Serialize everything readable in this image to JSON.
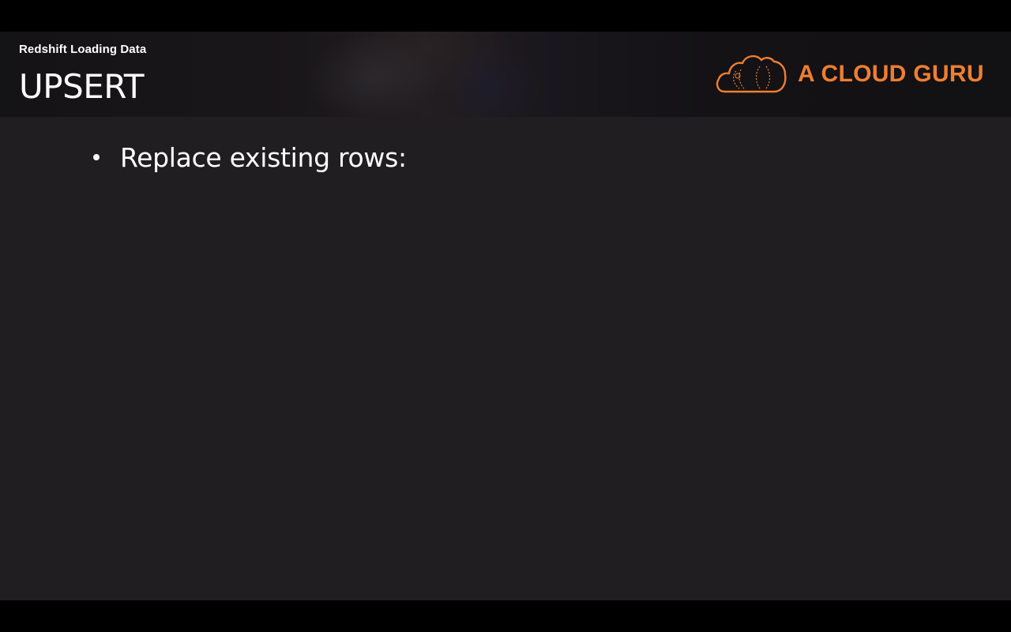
{
  "slide": {
    "subtitle": "Redshift Loading Data",
    "title": "UPSERT",
    "bullets": [
      {
        "text": "Replace existing rows:"
      }
    ]
  },
  "brand": {
    "logo_text": "A CLOUD GURU",
    "logo_icon": "cloud-icon",
    "accent_color": "#ee7f30"
  },
  "colors": {
    "slide_background": "#201e21",
    "letterbox": "#000000",
    "text": "#ffffff"
  }
}
